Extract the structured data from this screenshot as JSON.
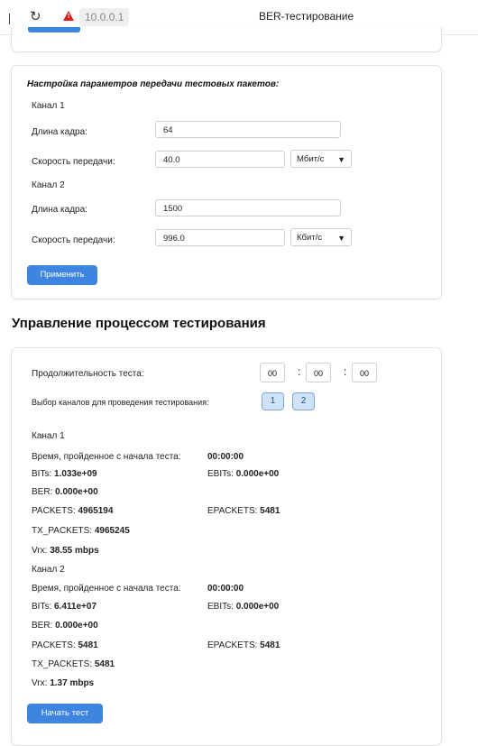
{
  "browser": {
    "url": "10.0.0.1",
    "tab_title": "BER-тестирование"
  },
  "settings": {
    "title": "Настройка параметров передачи тестовых пакетов:",
    "channel1": {
      "label": "Канал 1",
      "frame_length_label": "Длина кадра:",
      "frame_length_value": "64",
      "speed_label": "Скорость передачи:",
      "speed_value": "40.0",
      "unit": "Мбит/с"
    },
    "channel2": {
      "label": "Канал 2",
      "frame_length_label": "Длина кадра:",
      "frame_length_value": "1500",
      "speed_label": "Скорость передачи:",
      "speed_value": "996.0",
      "unit": "Кбит/с"
    },
    "apply_label": "Применить"
  },
  "control": {
    "section_title": "Управление процессом тестирования",
    "duration_label": "Продолжительность теста:",
    "hours": "00",
    "minutes": "00",
    "seconds": "00",
    "colon": ":",
    "channels_label": "Выбор каналов для проведения тестирования:",
    "channel_buttons": [
      "1",
      "2"
    ],
    "start_label": "Начать тест"
  },
  "stats": {
    "ch1": {
      "label": "Канал 1",
      "elapsed_label": "Время, пройденное с начала теста:",
      "elapsed_value": "00:00:00",
      "bits_label": "BITs:",
      "bits_value": "1.033e+09",
      "ebits_label": "EBITs:",
      "ebits_value": "0.000e+00",
      "ber_label": "BER:",
      "ber_value": "0.000e+00",
      "packets_label": "PACKETS:",
      "packets_value": "4965194",
      "epackets_label": "EPACKETS:",
      "epackets_value": "5481",
      "tx_label": "TX_PACKETS:",
      "tx_value": "4965245",
      "vrx_label": "Vrx:",
      "vrx_value": "38.55 mbps"
    },
    "ch2": {
      "label": "Канал 2",
      "elapsed_label": "Время, пройденное с начала теста:",
      "elapsed_value": "00:00:00",
      "bits_label": "BITs:",
      "bits_value": "6.411e+07",
      "ebits_label": "EBITs:",
      "ebits_value": "0.000e+00",
      "ber_label": "BER:",
      "ber_value": "0.000e+00",
      "packets_label": "PACKETS:",
      "packets_value": "5481",
      "epackets_label": "EPACKETS:",
      "epackets_value": "5481",
      "tx_label": "TX_PACKETS:",
      "tx_value": "5481",
      "vrx_label": "Vrx:",
      "vrx_value": "1.37 mbps"
    }
  },
  "colors": {
    "accent": "#3d85e0",
    "warning": "#d62020",
    "channel_button_bg": "#cfe2f7"
  }
}
